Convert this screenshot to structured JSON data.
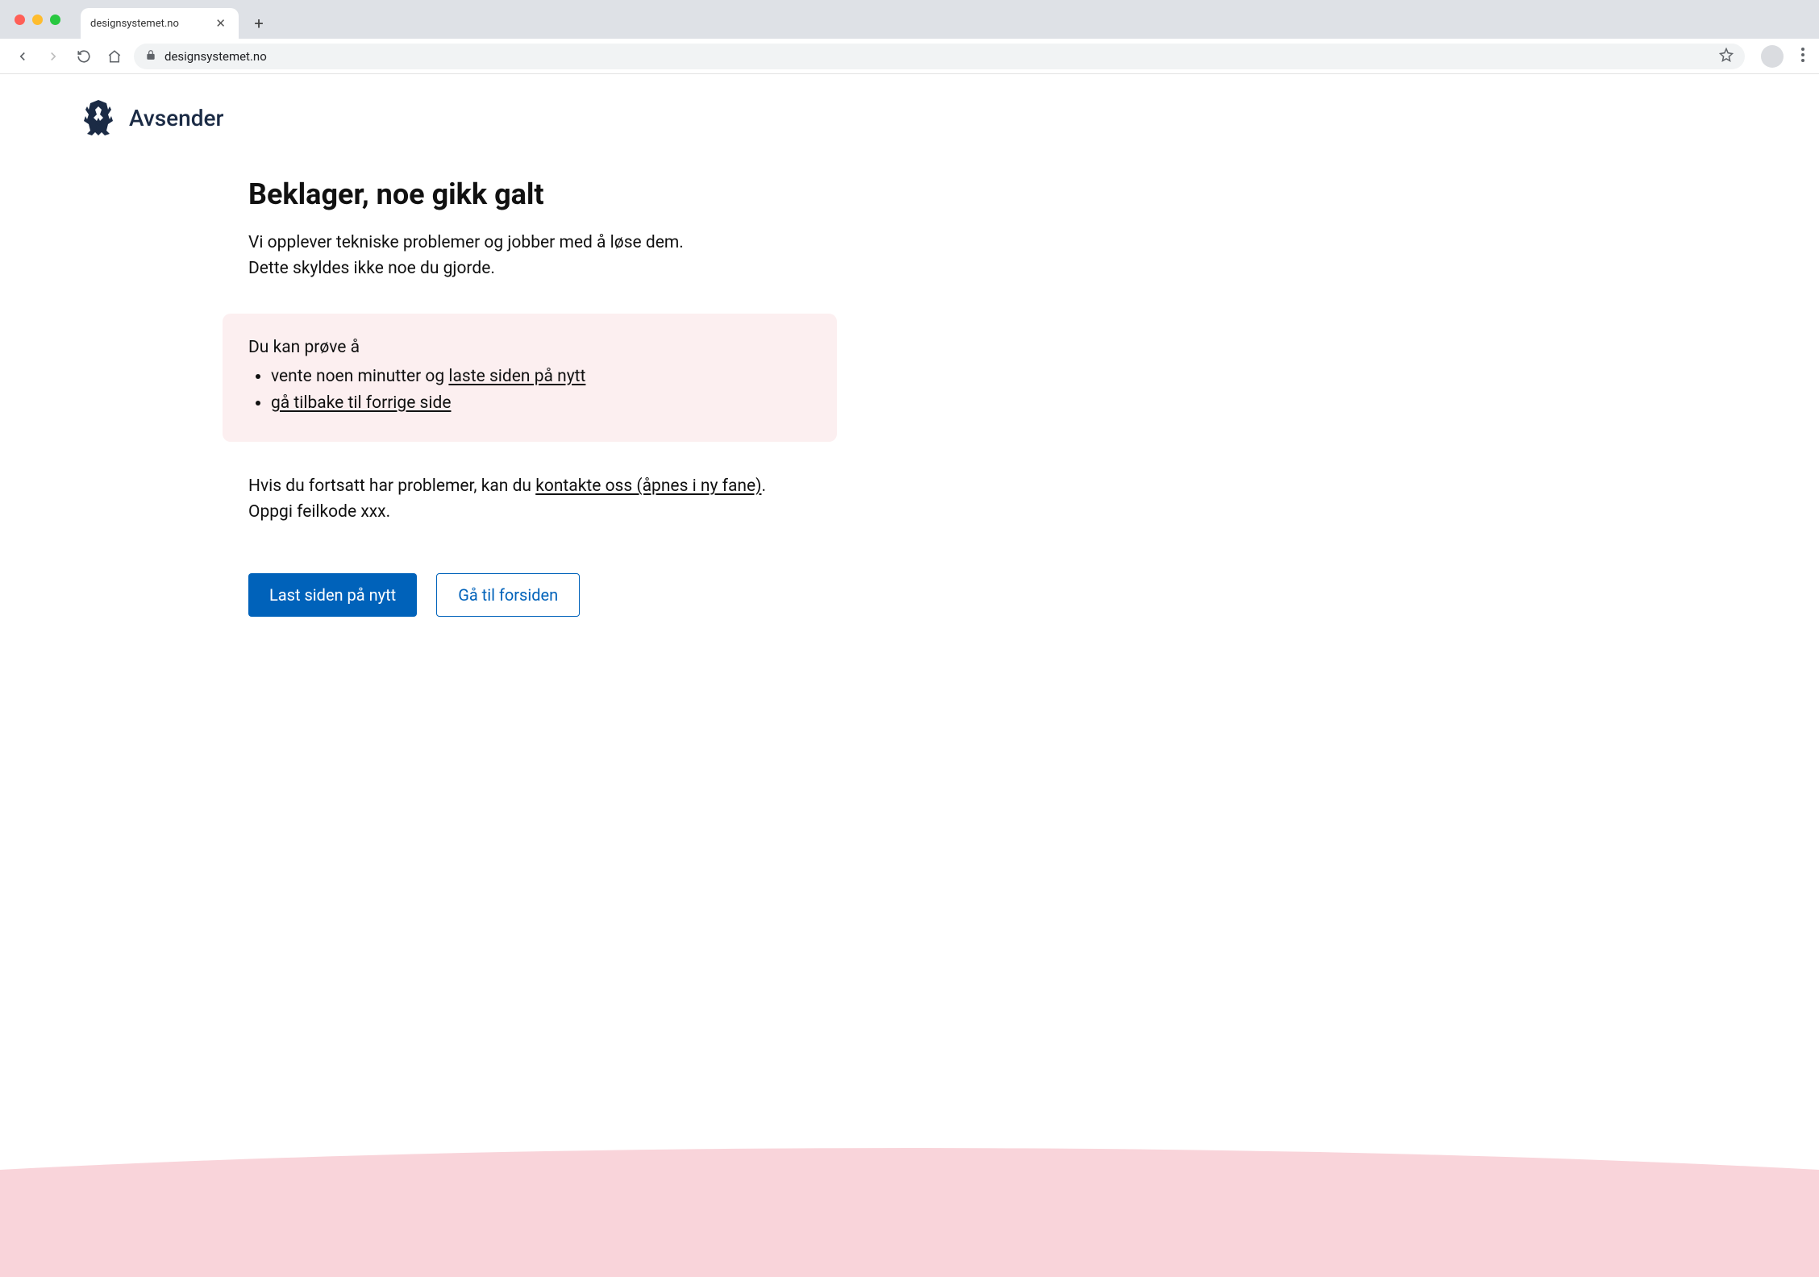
{
  "browser": {
    "tab_title": "designsystemet.no",
    "url": "designsystemet.no"
  },
  "header": {
    "brand": "Avsender"
  },
  "main": {
    "title": "Beklager, noe gikk galt",
    "intro_line1": "Vi opplever tekniske problemer og jobber med å løse dem.",
    "intro_line2": "Dette skyldes ikke noe du gjorde.",
    "panel": {
      "heading": "Du kan prøve å",
      "item1_prefix": "vente noen minutter og ",
      "item1_link": "laste siden på nytt",
      "item2_link": "gå tilbake til forrige side"
    },
    "contact_prefix": "Hvis du fortsatt har problemer, kan du ",
    "contact_link": "kontakte oss (åpnes i ny fane)",
    "contact_suffix": ".",
    "error_code_line": "Oppgi feilkode xxx.",
    "buttons": {
      "primary": "Last siden på nytt",
      "secondary": "Gå til forsiden"
    }
  },
  "colors": {
    "accent": "#0062ba",
    "panel_bg": "#fceff0",
    "wave_bg": "#f9d4da",
    "brand_dark": "#1b2b45"
  }
}
